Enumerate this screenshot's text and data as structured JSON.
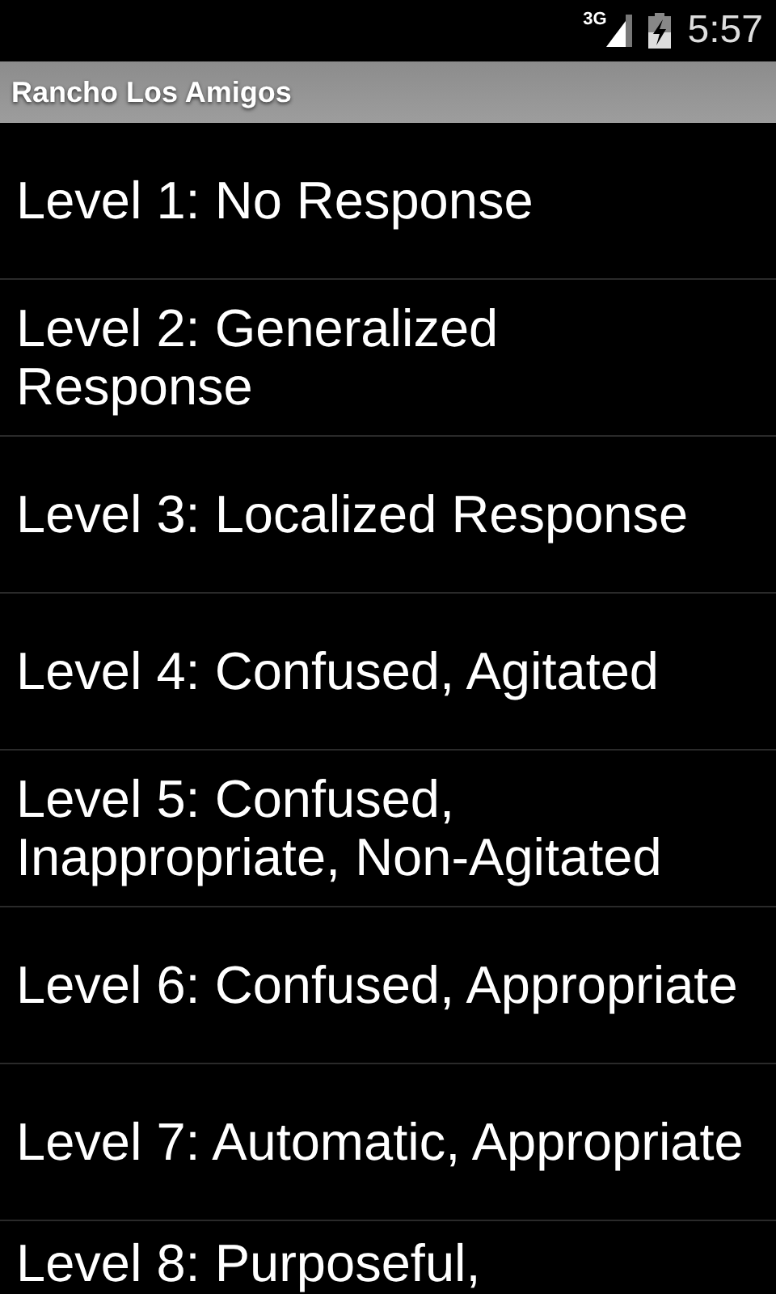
{
  "status_bar": {
    "network": "3G",
    "time": "5:57"
  },
  "title_bar": {
    "title": "Rancho Los Amigos"
  },
  "list": [
    {
      "label": "Level 1: No Response"
    },
    {
      "label": "Level 2: Generalized Response"
    },
    {
      "label": "Level 3: Localized Response"
    },
    {
      "label": "Level 4: Confused, Agitated"
    },
    {
      "label": "Level 5: Confused, Inappropriate, Non-Agitated"
    },
    {
      "label": "Level 6: Confused, Appropriate"
    },
    {
      "label": "Level 7: Automatic, Appropriate"
    },
    {
      "label": "Level 8: Purposeful,"
    }
  ]
}
